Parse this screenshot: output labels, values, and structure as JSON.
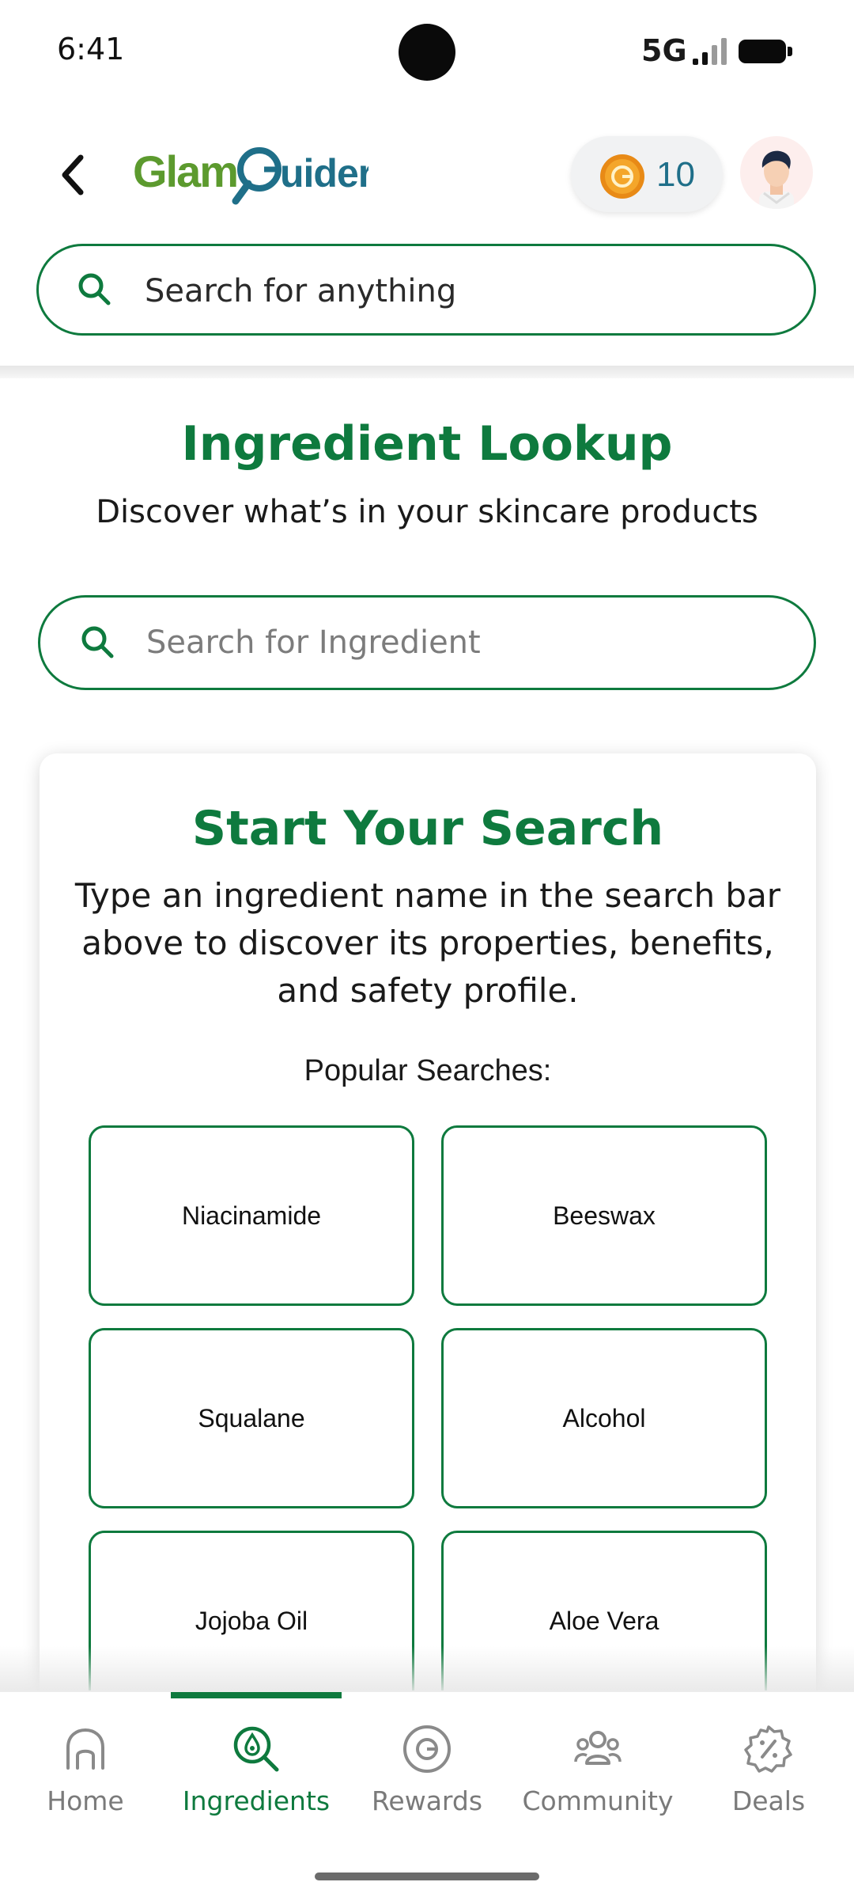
{
  "status_bar": {
    "time": "6:41",
    "network": "5G"
  },
  "header": {
    "logo_text": "GlamGuider",
    "coin_count": "10"
  },
  "global_search": {
    "placeholder": "Search for anything"
  },
  "main": {
    "title": "Ingredient Lookup",
    "subtitle": "Discover what’s in your skincare products",
    "ingredient_search_placeholder": "Search for Ingredient"
  },
  "card": {
    "title": "Start Your Search",
    "body": "Type an ingredient name in the search bar above to discover its properties, benefits, and safety profile.",
    "popular_label": "Popular Searches:",
    "popular": [
      "Niacinamide",
      "Beeswax",
      "Squalane",
      "Alcohol",
      "Jojoba Oil",
      "Aloe Vera"
    ]
  },
  "nav": {
    "items": [
      {
        "label": "Home",
        "icon": "home-icon"
      },
      {
        "label": "Ingredients",
        "icon": "ingredients-search-icon",
        "active": true
      },
      {
        "label": "Rewards",
        "icon": "rewards-coin-icon"
      },
      {
        "label": "Community",
        "icon": "community-icon"
      },
      {
        "label": "Deals",
        "icon": "deals-badge-icon"
      }
    ]
  },
  "colors": {
    "brand_green": "#0e7a3e",
    "coin_text": "#1f6f89",
    "inactive": "#7a7a7a"
  }
}
